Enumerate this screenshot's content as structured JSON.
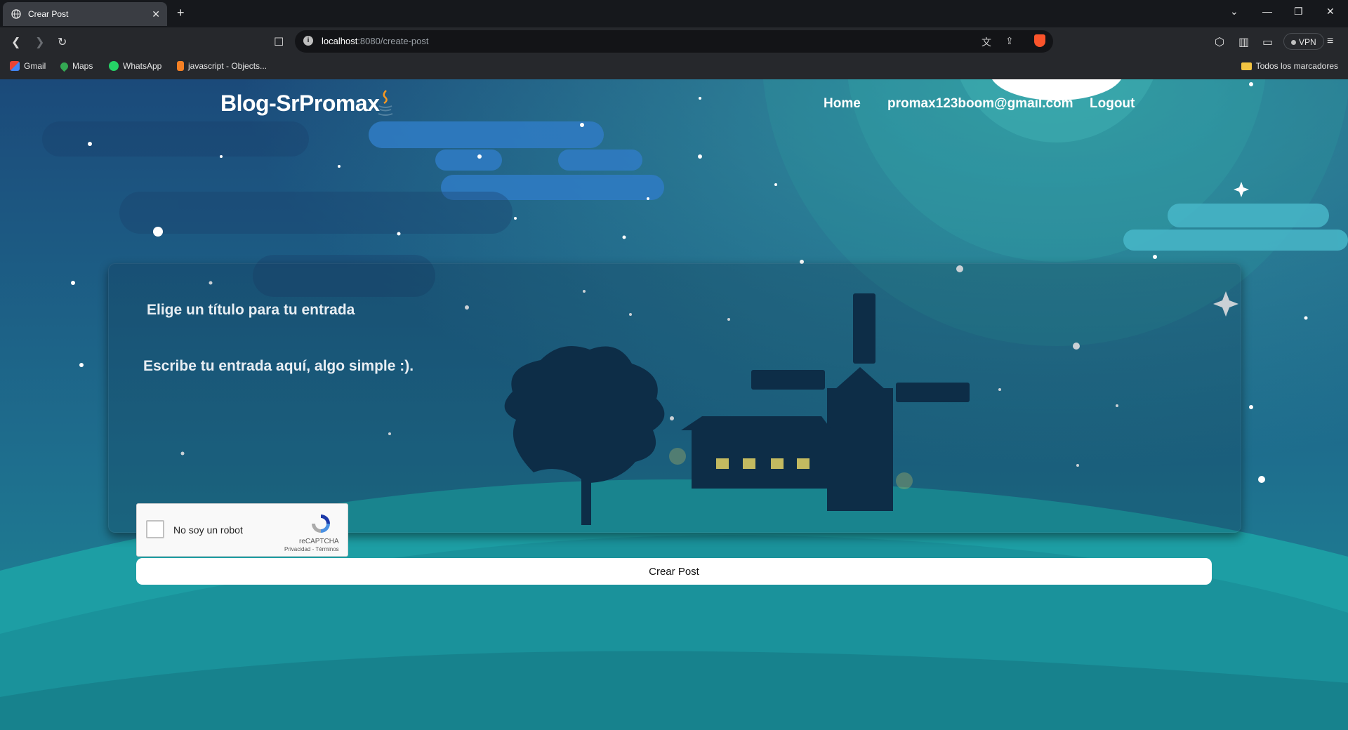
{
  "browser": {
    "tab_title": "Crear Post",
    "url_host": "localhost",
    "url_path": ":8080/create-post",
    "vpn_label": "VPN",
    "bookmarks": [
      {
        "label": "Gmail",
        "icon": "gmail-icon"
      },
      {
        "label": "Maps",
        "icon": "maps-icon"
      },
      {
        "label": "WhatsApp",
        "icon": "whatsapp-icon"
      },
      {
        "label": "javascript - Objects...",
        "icon": "stackoverflow-icon"
      }
    ],
    "all_bookmarks": "Todos los marcadores"
  },
  "navbar": {
    "brand": "Blog-SrPromax",
    "links": [
      "Home",
      "promax123boom@gmail.com",
      "Logout"
    ]
  },
  "form": {
    "title_placeholder": "Elige un título para tu entrada",
    "body_placeholder": "Escribe tu entrada aquí, algo simple :).",
    "captcha": {
      "label": "No soy un robot",
      "brand": "reCAPTCHA",
      "terms": "Privacidad - Términos"
    },
    "submit_label": "Crear Post"
  },
  "colors": {
    "sky_top": "#1b4a7a",
    "sky_bottom": "#1f8a96",
    "hill": "#1aa3a3",
    "silhouette": "#0d2f4a",
    "window_light": "#f7e36a"
  }
}
